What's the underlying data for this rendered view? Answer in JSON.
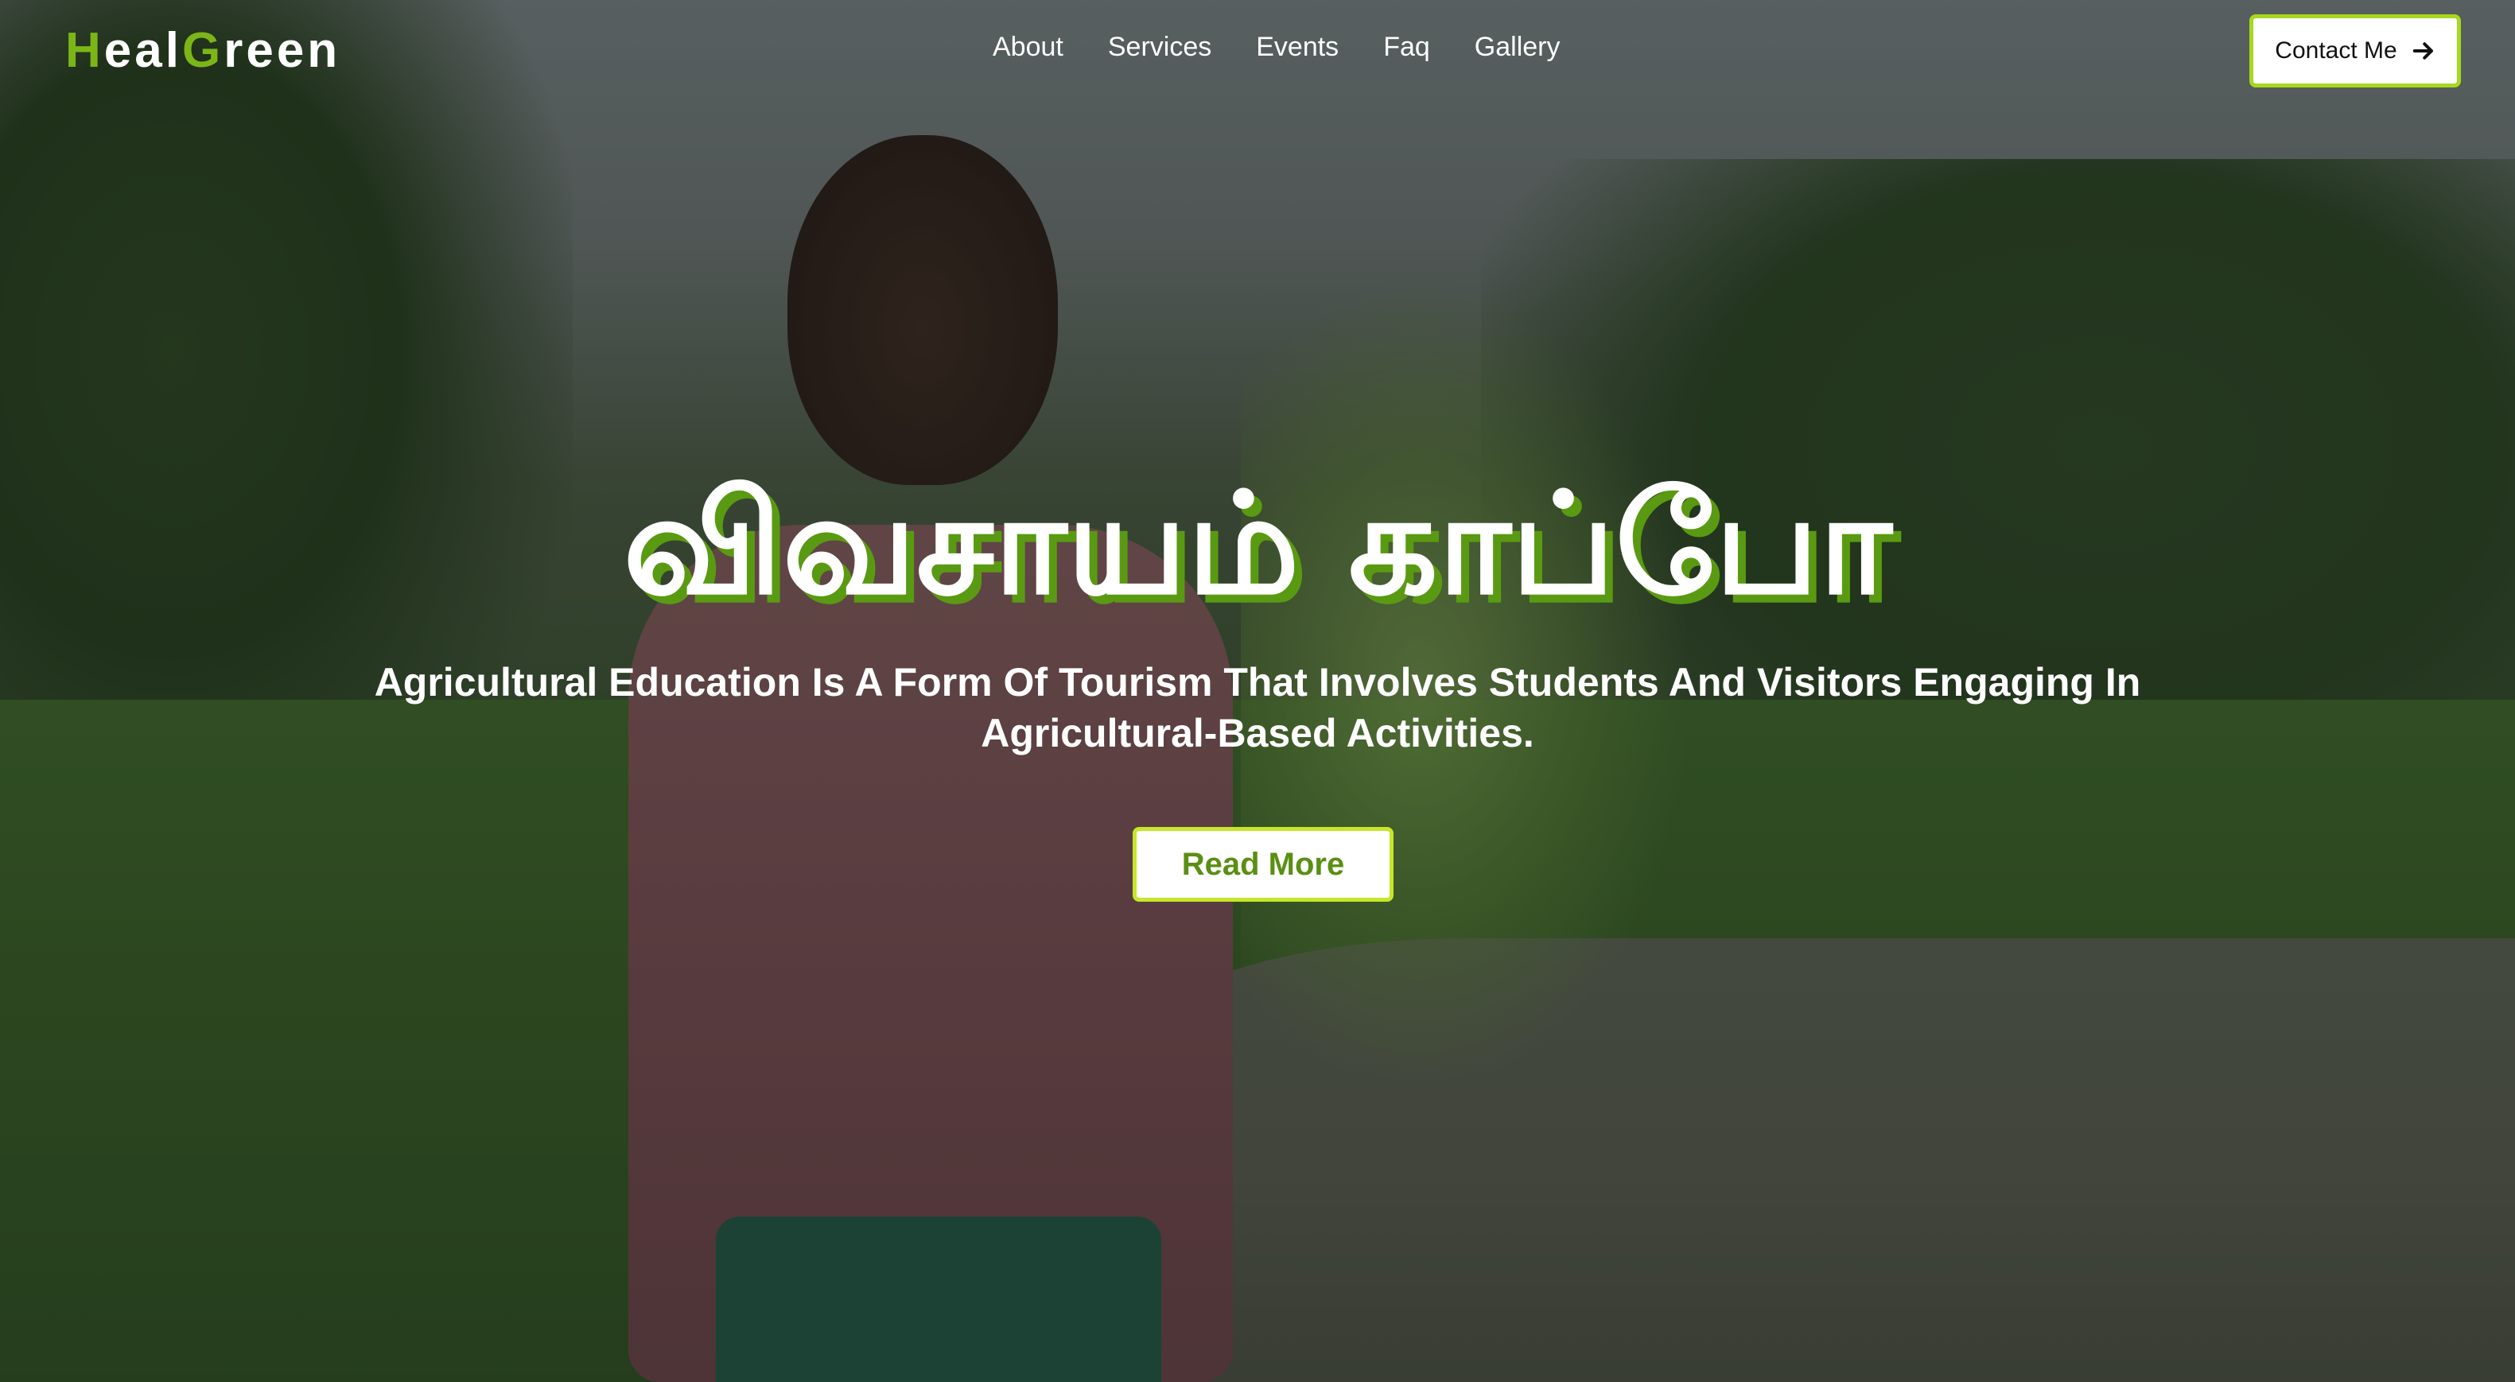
{
  "header": {
    "logo": {
      "letters": [
        {
          "text": "H",
          "accent": true
        },
        {
          "text": "eal",
          "accent": false
        },
        {
          "text": "G",
          "accent": true
        },
        {
          "text": "reen",
          "accent": false
        }
      ]
    },
    "nav": [
      {
        "label": "About"
      },
      {
        "label": "Services"
      },
      {
        "label": "Events"
      },
      {
        "label": "Faq"
      },
      {
        "label": "Gallery"
      }
    ],
    "contact_button": {
      "label": "Contact Me",
      "icon": "arrow-right-icon"
    }
  },
  "hero": {
    "title": "விவசாயம் காப்போ",
    "subtitle": "Agricultural Education Is A Form Of Tourism That Involves Students And Visitors Engaging In Agricultural-Based Activities.",
    "read_more_label": "Read More"
  },
  "colors": {
    "accent": "#7cb518",
    "button_border": "#a8d81e",
    "read_more_text": "#5a8f12",
    "title_shadow": "#5a9a12"
  }
}
